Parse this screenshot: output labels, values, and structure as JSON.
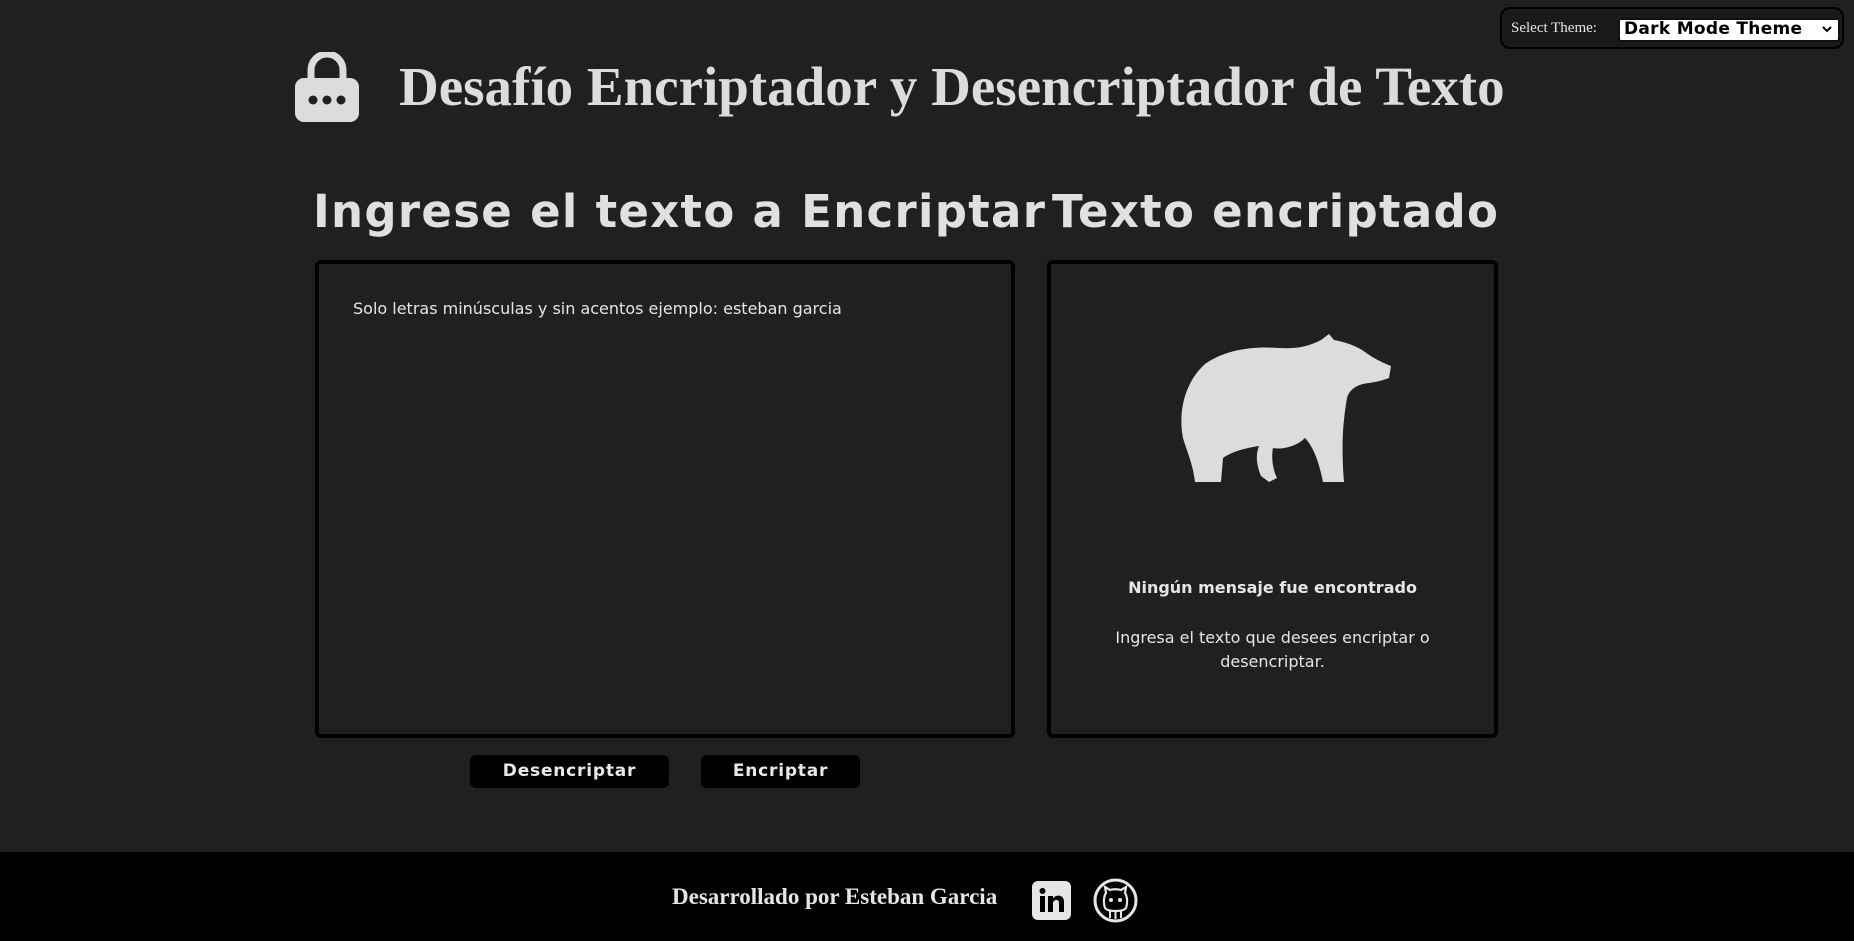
{
  "theme": {
    "label": "Select Theme:",
    "selected": "Dark Mode Theme"
  },
  "header": {
    "title": "Desafío Encriptador y Desencriptador de Texto",
    "icon": "lock-icon"
  },
  "input_section": {
    "heading": "Ingrese el texto a Encriptar",
    "placeholder": "Solo letras minúsculas y sin acentos ejemplo: esteban garcia"
  },
  "output_section": {
    "heading": "Texto encriptado",
    "icon": "bear-icon",
    "empty_title": "Ningún mensaje fue encontrado",
    "empty_text": "Ingresa el texto que desees encriptar o desencriptar."
  },
  "buttons": {
    "decrypt": "Desencriptar",
    "encrypt": "Encriptar"
  },
  "footer": {
    "text": "Desarrollado por Esteban Garcia",
    "icons": [
      "linkedin-icon",
      "github-icon"
    ]
  },
  "colors": {
    "background": "#202020",
    "footer_background": "#000000",
    "text": "#e0e0e0",
    "button_background": "#000000"
  }
}
